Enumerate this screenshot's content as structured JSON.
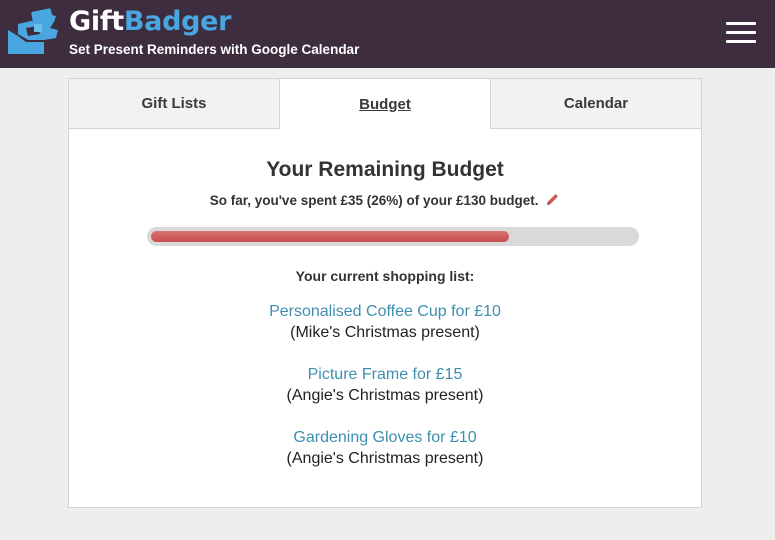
{
  "header": {
    "brand_part1": "Gift",
    "brand_part2": "Badger",
    "tagline": "Set Present Reminders with Google Calendar",
    "menu_icon": "hamburger-menu-icon",
    "logo_icon": "gift-hand-logo-icon",
    "colors": {
      "bar": "#3d2d3f",
      "brand_accent": "#49a6e0"
    }
  },
  "tabs": [
    {
      "label": "Gift Lists",
      "active": false
    },
    {
      "label": "Budget",
      "active": true
    },
    {
      "label": "Calendar",
      "active": false
    }
  ],
  "budget": {
    "title": "Your Remaining Budget",
    "summary": "So far, you've spent £35 (26%) of your £130 budget.",
    "edit_icon": "pencil-icon",
    "spent_fraction": 0.26,
    "bar_color": "#d06060"
  },
  "shopping_list": {
    "heading": "Your current shopping list:",
    "items": [
      {
        "item": "Personalised Coffee Cup for £10",
        "recipient": "(Mike's Christmas present)"
      },
      {
        "item": "Picture Frame for £15",
        "recipient": "(Angie's Christmas present)"
      },
      {
        "item": "Gardening Gloves for £10",
        "recipient": "(Angie's Christmas present)"
      }
    ]
  }
}
